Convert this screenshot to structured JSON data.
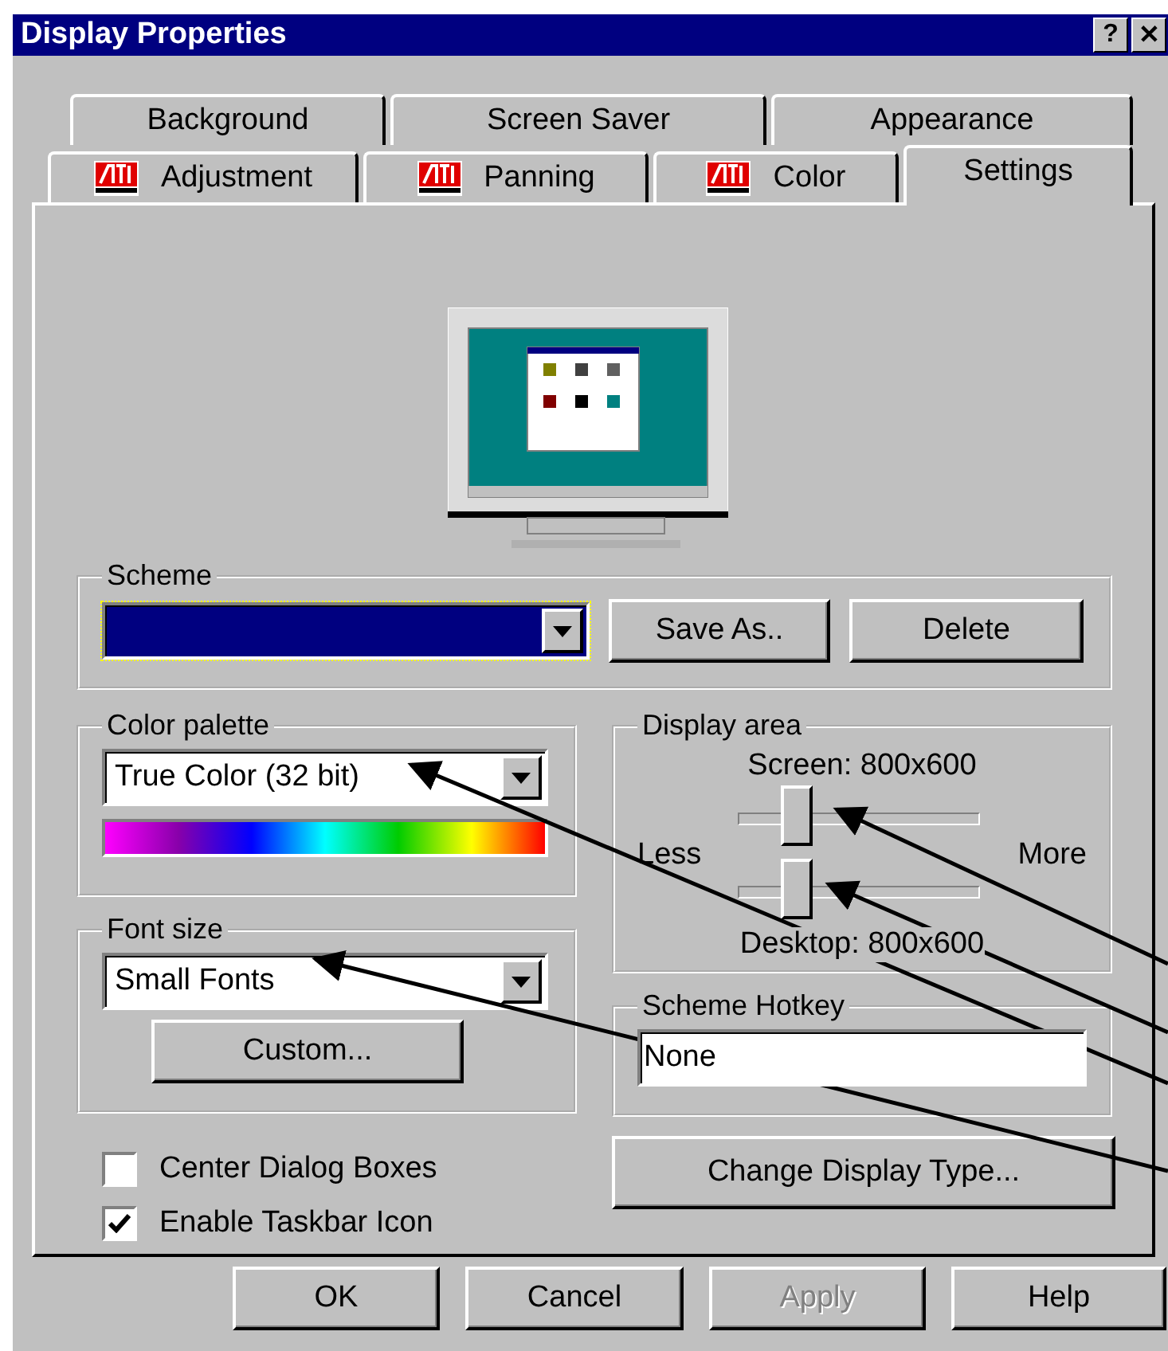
{
  "window": {
    "title": "Display Properties",
    "controls": [
      "?",
      "✕"
    ]
  },
  "tabs": {
    "back_row": [
      {
        "label": "Background",
        "icon": false,
        "selected": false
      },
      {
        "label": "Screen Saver",
        "icon": false,
        "selected": false
      },
      {
        "label": "Appearance",
        "icon": false,
        "selected": false
      }
    ],
    "front_row": [
      {
        "label": "Adjustment",
        "icon": true,
        "selected": false
      },
      {
        "label": "Panning",
        "icon": true,
        "selected": false
      },
      {
        "label": "Color",
        "icon": true,
        "selected": false
      },
      {
        "label": "Settings",
        "icon": false,
        "selected": true
      }
    ]
  },
  "scheme": {
    "title": "Scheme",
    "buttons": [
      "Save As..",
      "Delete"
    ]
  },
  "color_palette": {
    "title": "Color palette",
    "value": "True Color (32 bit)"
  },
  "font_size": {
    "title": "Font size",
    "value": "Small Fonts",
    "button": "Custom..."
  },
  "checkboxes": [
    {
      "label": "Center Dialog Boxes",
      "checked": false
    },
    {
      "label": "Enable Taskbar Icon",
      "checked": true
    }
  ],
  "display_area": {
    "title": "Display area",
    "less": "Less",
    "more": "More",
    "sliders": [
      {
        "label": "Screen: 800x600",
        "level": 0.24
      },
      {
        "label": "Desktop: 800x600",
        "level": 0.24
      }
    ]
  },
  "scheme_hotkey": {
    "title": "Scheme Hotkey",
    "value": "None"
  },
  "change_display_type": "Change Display Type...",
  "buttons": [
    {
      "label": "OK",
      "disabled": false
    },
    {
      "label": "Cancel",
      "disabled": false
    },
    {
      "label": "Apply",
      "disabled": true
    },
    {
      "label": "Help",
      "disabled": false
    }
  ]
}
